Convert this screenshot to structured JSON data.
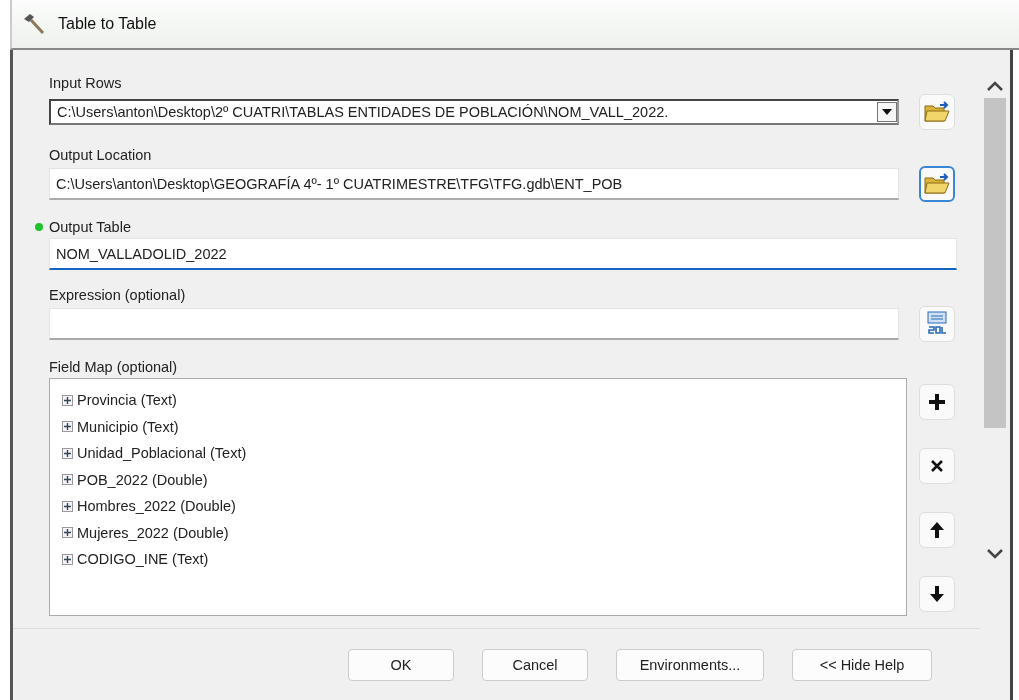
{
  "window": {
    "title": "Table to Table"
  },
  "parameters": [
    {
      "label": "Input Rows",
      "value": "C:\\Users\\anton\\Desktop\\2º CUATRI\\TABLAS ENTIDADES DE POBLACIÓN\\NOM_VALL_2022.",
      "kind": "dropdown",
      "required": false,
      "focused": false,
      "action": {
        "kind": "browse",
        "focused": false
      }
    },
    {
      "label": "Output Location",
      "value": "C:\\Users\\anton\\Desktop\\GEOGRAFÍA 4º- 1º CUATRIMESTRE\\TFG\\TFG.gdb\\ENT_POB",
      "kind": "text",
      "required": false,
      "focused": false,
      "action": {
        "kind": "browse",
        "focused": true
      }
    },
    {
      "label": "Output Table",
      "value": "NOM_VALLADOLID_2022",
      "kind": "text",
      "required": true,
      "focused": true
    },
    {
      "label": "Expression (optional)",
      "kind": "text",
      "required": false,
      "focused": false,
      "action": {
        "kind": "sql",
        "focused": false
      }
    }
  ],
  "field_map": {
    "label": "Field Map (optional)",
    "items": [
      {
        "label": "Provincia (Text)",
        "expanded": false
      },
      {
        "label": "Municipio (Text)",
        "expanded": false
      },
      {
        "label": "Unidad_Poblacional (Text)",
        "expanded": false
      },
      {
        "label": "POB_2022 (Double)",
        "expanded": false
      },
      {
        "label": "Hombres_2022 (Double)",
        "expanded": false
      },
      {
        "label": "Mujeres_2022 (Double)",
        "expanded": false
      },
      {
        "label": "CODIGO_INE (Text)",
        "expanded": false
      }
    ],
    "tools": [
      {
        "kind": "add"
      },
      {
        "kind": "remove"
      },
      {
        "kind": "up"
      },
      {
        "kind": "down"
      }
    ]
  },
  "buttons": [
    "OK",
    "Cancel",
    "Environments...",
    "<< Hide Help"
  ]
}
